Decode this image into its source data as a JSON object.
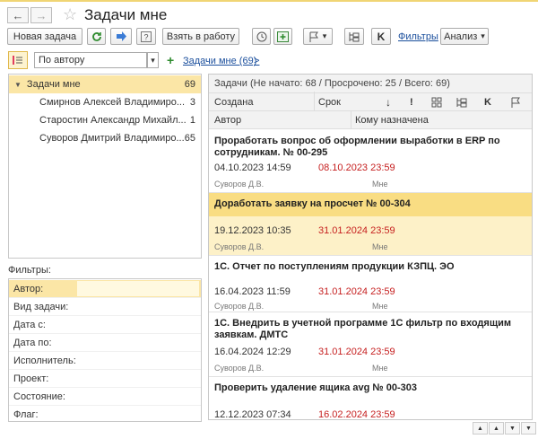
{
  "window": {
    "title": "Задачи мне",
    "back_icon": "←",
    "forward_icon": "→",
    "star_icon": "☆"
  },
  "toolbar": {
    "new_task": "Новая задача",
    "take_to_work": "Взять в работу",
    "k_label": "K",
    "filters": "Фильтры",
    "analysis": "Анализ",
    "dropdown_arrow": "▾"
  },
  "group_row": {
    "group_by": "По автору",
    "plus": "+",
    "tasks_link": "Задачи мне (69)",
    "more": ">"
  },
  "tree": {
    "root": {
      "label": "Задачи мне",
      "count": "69"
    },
    "items": [
      {
        "label": "Смирнов Алексей Владимиро...",
        "count": "3"
      },
      {
        "label": "Старостин Александр Михайл...",
        "count": "1"
      },
      {
        "label": "Суворов Дмитрий Владимиро...",
        "count": "65"
      }
    ]
  },
  "filters": {
    "title": "Фильтры:",
    "rows": [
      "Автор:",
      "Вид задачи:",
      "Дата с:",
      "Дата по:",
      "Исполнитель:",
      "Проект:",
      "Состояние:",
      "Флаг:"
    ]
  },
  "tasks_panel": {
    "summary": "Задачи (Не начато: 68 / Просрочено: 25 / Всего: 69)",
    "columns": {
      "created": "Создана",
      "due": "Срок",
      "author": "Автор",
      "assignee": "Кому назначена",
      "k": "K"
    },
    "tasks": [
      {
        "title": "Проработать вопрос об оформлении выработки в ERP по сотрудникам. № 00-295",
        "created": "04.10.2023 14:59",
        "due": "08.10.2023 23:59",
        "author": "Суворов Д.В.",
        "assignee": "Мне"
      },
      {
        "title": "Доработать заявку на просчет  № 00-304",
        "created": "19.12.2023 10:35",
        "due": "31.01.2024 23:59",
        "author": "Суворов Д.В.",
        "assignee": "Мне"
      },
      {
        "title": "1С. Отчет по поступлениям продукции КЗПЦ. ЭО",
        "created": "16.04.2023 11:59",
        "due": "31.01.2024 23:59",
        "author": "Суворов Д.В.",
        "assignee": "Мне"
      },
      {
        "title": "1С. Внедрить в учетной программе 1С фильтр по входящим заявкам. ДМТС",
        "created": "16.04.2024 12:29",
        "due": "31.01.2024 23:59",
        "author": "Суворов Д.В.",
        "assignee": "Мне"
      },
      {
        "title": "Проверить удаление ящика avg № 00-303",
        "created": "12.12.2023 07:34",
        "due": "16.02.2024 23:59",
        "author": "",
        "assignee": ""
      }
    ]
  },
  "colors": {
    "selection": "#fbe6a6",
    "due_red": "#c62020",
    "link": "#1a4e9c",
    "accent_yellow": "#f0d574"
  }
}
